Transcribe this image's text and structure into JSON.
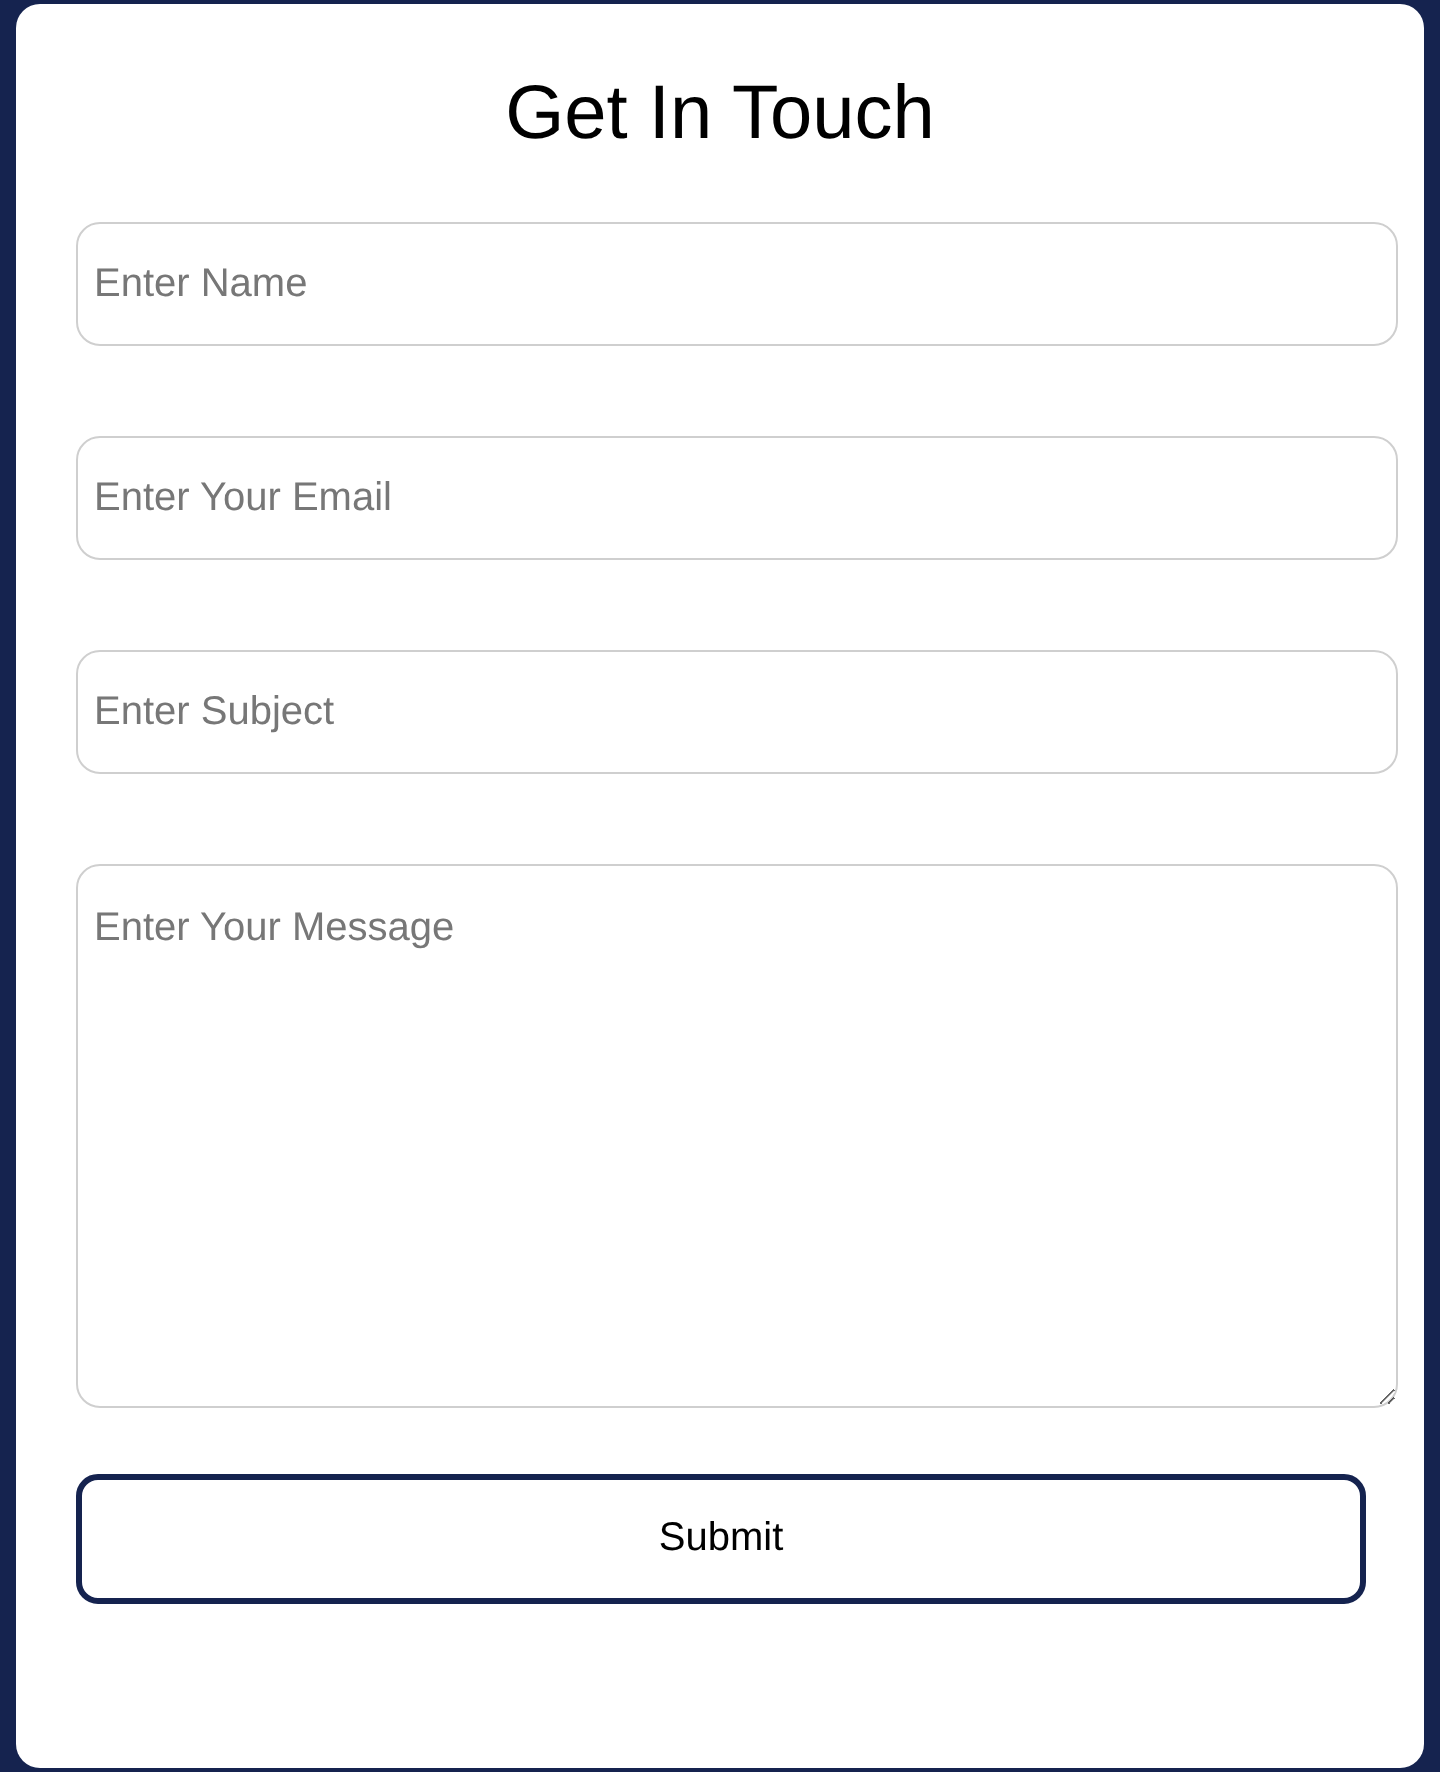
{
  "title": "Get In Touch",
  "fields": [
    {
      "kind": "input",
      "placeholder": "Enter Name"
    },
    {
      "kind": "input",
      "placeholder": "Enter Your Email"
    },
    {
      "kind": "input",
      "placeholder": "Enter Subject"
    },
    {
      "kind": "textarea",
      "placeholder": "Enter Your Message"
    }
  ],
  "submit_button": {
    "label": "Submit"
  }
}
